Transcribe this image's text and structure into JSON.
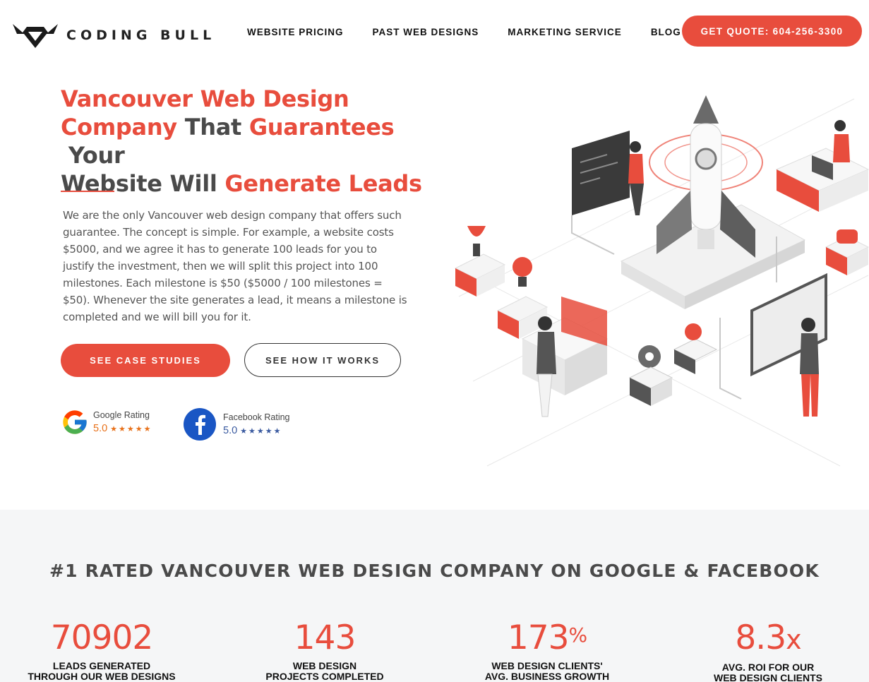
{
  "brand": {
    "name": "CODING BULL",
    "accent": "#e84d3d",
    "text": "#4a4a4a"
  },
  "nav": {
    "items": [
      {
        "label": "WEBSITE PRICING"
      },
      {
        "label": "PAST WEB DESIGNS"
      },
      {
        "label": "MARKETING SERVICE"
      },
      {
        "label": "BLOG"
      }
    ],
    "cta": "GET QUOTE: 604-256-3300"
  },
  "hero": {
    "title": {
      "p1": "Vancouver Web Design",
      "p2": "Company",
      "p3": " That ",
      "p4": "Guarantees",
      "p5": " Your",
      "p6": "Website Will ",
      "p7": "Generate Leads"
    },
    "body": "We are the only Vancouver web design company that offers such guarantee. The concept is simple. For example, a website costs $5000, and we agree it has to generate 100 leads for you to justify the investment, then we will split this project into 100 milestones. Each milestone is $50 ($5000 / 100 milestones = $50). Whenever the site generates a lead, it means a milestone is completed and we will bill you for it.",
    "primary_button": "SEE CASE STUDIES",
    "secondary_button": "SEE HOW IT WORKS"
  },
  "ratings": {
    "google": {
      "label": "Google Rating",
      "score": "5.0",
      "stars": "★★★★★",
      "icon": "google-g-icon"
    },
    "facebook": {
      "label": "Facebook Rating",
      "score": "5.0",
      "stars": "★★★★★",
      "icon": "facebook-f-icon"
    }
  },
  "stats": {
    "title": "#1 RATED VANCOUVER WEB DESIGN COMPANY ON GOOGLE & FACEBOOK",
    "items": [
      {
        "value": "70902",
        "suffix": "",
        "line1": "LEADS GENERATED",
        "line2": "THROUGH OUR WEB DESIGNS"
      },
      {
        "value": "143",
        "suffix": "",
        "line1": "WEB DESIGN",
        "line2": "PROJECTS COMPLETED"
      },
      {
        "value": "173",
        "suffix": "%",
        "line1": "WEB DESIGN CLIENTS'",
        "line2": "AVG. BUSINESS GROWTH"
      },
      {
        "value": "8.3",
        "suffix": "x",
        "line1": "AVG. ROI FOR OUR",
        "line2": "WEB DESIGN CLIENTS"
      }
    ]
  }
}
